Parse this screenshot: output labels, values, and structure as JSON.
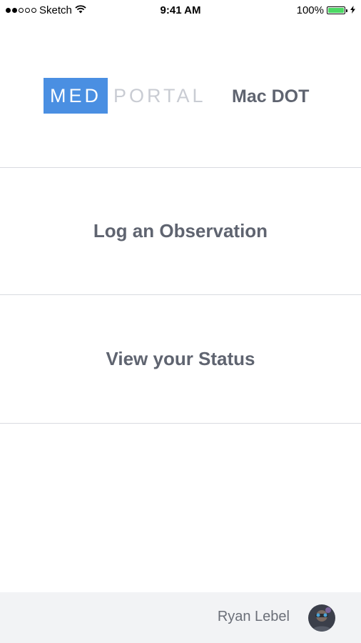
{
  "status_bar": {
    "carrier": "Sketch",
    "time": "9:41 AM",
    "battery_percent": "100%",
    "signal_bars_filled": 2,
    "signal_bars_total": 5,
    "battery_color": "#4cd964",
    "wifi_icon": "wifi-icon",
    "charging_icon": "lightning-bolt-icon"
  },
  "header": {
    "logo_primary": "MED",
    "logo_secondary": "PORTAL",
    "org_name": "Mac DOT",
    "logo_color": "#4a8fe2"
  },
  "menu": {
    "items": [
      {
        "label": "Log an Observation"
      },
      {
        "label": "View your Status"
      }
    ]
  },
  "footer": {
    "user_name": "Ryan Lebel"
  }
}
